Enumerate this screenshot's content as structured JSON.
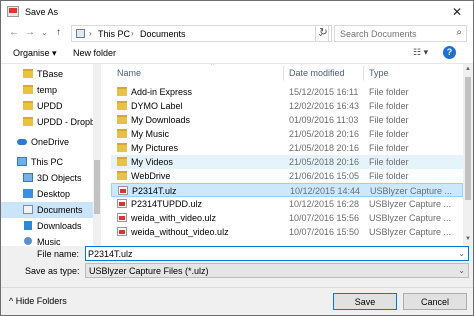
{
  "window": {
    "title": "Save As",
    "close_glyph": "✕"
  },
  "nav": {
    "back_glyph": "←",
    "forward_glyph": "→",
    "recent_glyph": "⌄",
    "up_glyph": "↑",
    "breadcrumb": [
      "This PC",
      "Documents"
    ],
    "separator_glyph": "›",
    "address_dropdown_glyph": "⌄",
    "refresh_glyph": "↻",
    "search_placeholder": "Search Documents",
    "search_glyph": "⌕"
  },
  "toolbar": {
    "organise": "Organise ▾",
    "new_folder": "New folder",
    "view_glyph": "☷ ▾",
    "help_glyph": "?"
  },
  "sidebar": {
    "items": [
      {
        "label": "TBase",
        "icon": "folder-icon"
      },
      {
        "label": "temp",
        "icon": "folder-icon"
      },
      {
        "label": "UPDD",
        "icon": "folder-icon"
      },
      {
        "label": "UPDD - Dropbox",
        "icon": "folder-icon"
      },
      {
        "label": "OneDrive",
        "icon": "cloud-icon"
      },
      {
        "label": "This PC",
        "icon": "computer-icon"
      },
      {
        "label": "3D Objects",
        "icon": "3d-objects-icon"
      },
      {
        "label": "Desktop",
        "icon": "desktop-icon"
      },
      {
        "label": "Documents",
        "icon": "documents-icon"
      },
      {
        "label": "Downloads",
        "icon": "downloads-icon"
      },
      {
        "label": "Music",
        "icon": "music-icon"
      }
    ]
  },
  "list": {
    "sort_glyph": "^",
    "columns": {
      "name": "Name",
      "date": "Date modified",
      "type": "Type"
    },
    "rows": [
      {
        "name": "Add-in Express",
        "date": "15/12/2015 16:11",
        "type": "File folder",
        "icon": "folder-icon"
      },
      {
        "name": "DYMO Label",
        "date": "12/02/2016 16:43",
        "type": "File folder",
        "icon": "folder-icon"
      },
      {
        "name": "My Downloads",
        "date": "01/09/2016 11:03",
        "type": "File folder",
        "icon": "folder-icon"
      },
      {
        "name": "My Music",
        "date": "21/05/2018 20:16",
        "type": "File folder",
        "icon": "system-folder-icon"
      },
      {
        "name": "My Pictures",
        "date": "21/05/2018 20:16",
        "type": "File folder",
        "icon": "system-folder-icon"
      },
      {
        "name": "My Videos",
        "date": "21/05/2018 20:16",
        "type": "File folder",
        "icon": "system-folder-icon"
      },
      {
        "name": "WebDrive",
        "date": "21/06/2016 15:05",
        "type": "File folder",
        "icon": "folder-icon"
      },
      {
        "name": "P2314T.ulz",
        "date": "10/12/2015 14:44",
        "type": "USBlyzer Capture ...",
        "icon": "ulz-file-icon"
      },
      {
        "name": "P2314TUPDD.ulz",
        "date": "10/12/2015 16:28",
        "type": "USBlyzer Capture ...",
        "icon": "ulz-file-icon"
      },
      {
        "name": "weida_with_video.ulz",
        "date": "10/07/2016 15:56",
        "type": "USBlyzer Capture ...",
        "icon": "ulz-file-icon"
      },
      {
        "name": "weida_without_video.ulz",
        "date": "10/07/2016 15:50",
        "type": "USBlyzer Capture ...",
        "icon": "ulz-file-icon"
      }
    ],
    "scroll_up_glyph": "▲",
    "scroll_down_glyph": "▼"
  },
  "form": {
    "file_name_label": "File name:",
    "file_name_value": "P2314T.ulz",
    "save_as_type_label": "Save as type:",
    "save_as_type_value": "USBlyzer Capture Files (*.ulz)",
    "dropdown_glyph": "⌄"
  },
  "footer": {
    "hide_folders": "^ Hide Folders",
    "save": "Save",
    "cancel": "Cancel"
  }
}
